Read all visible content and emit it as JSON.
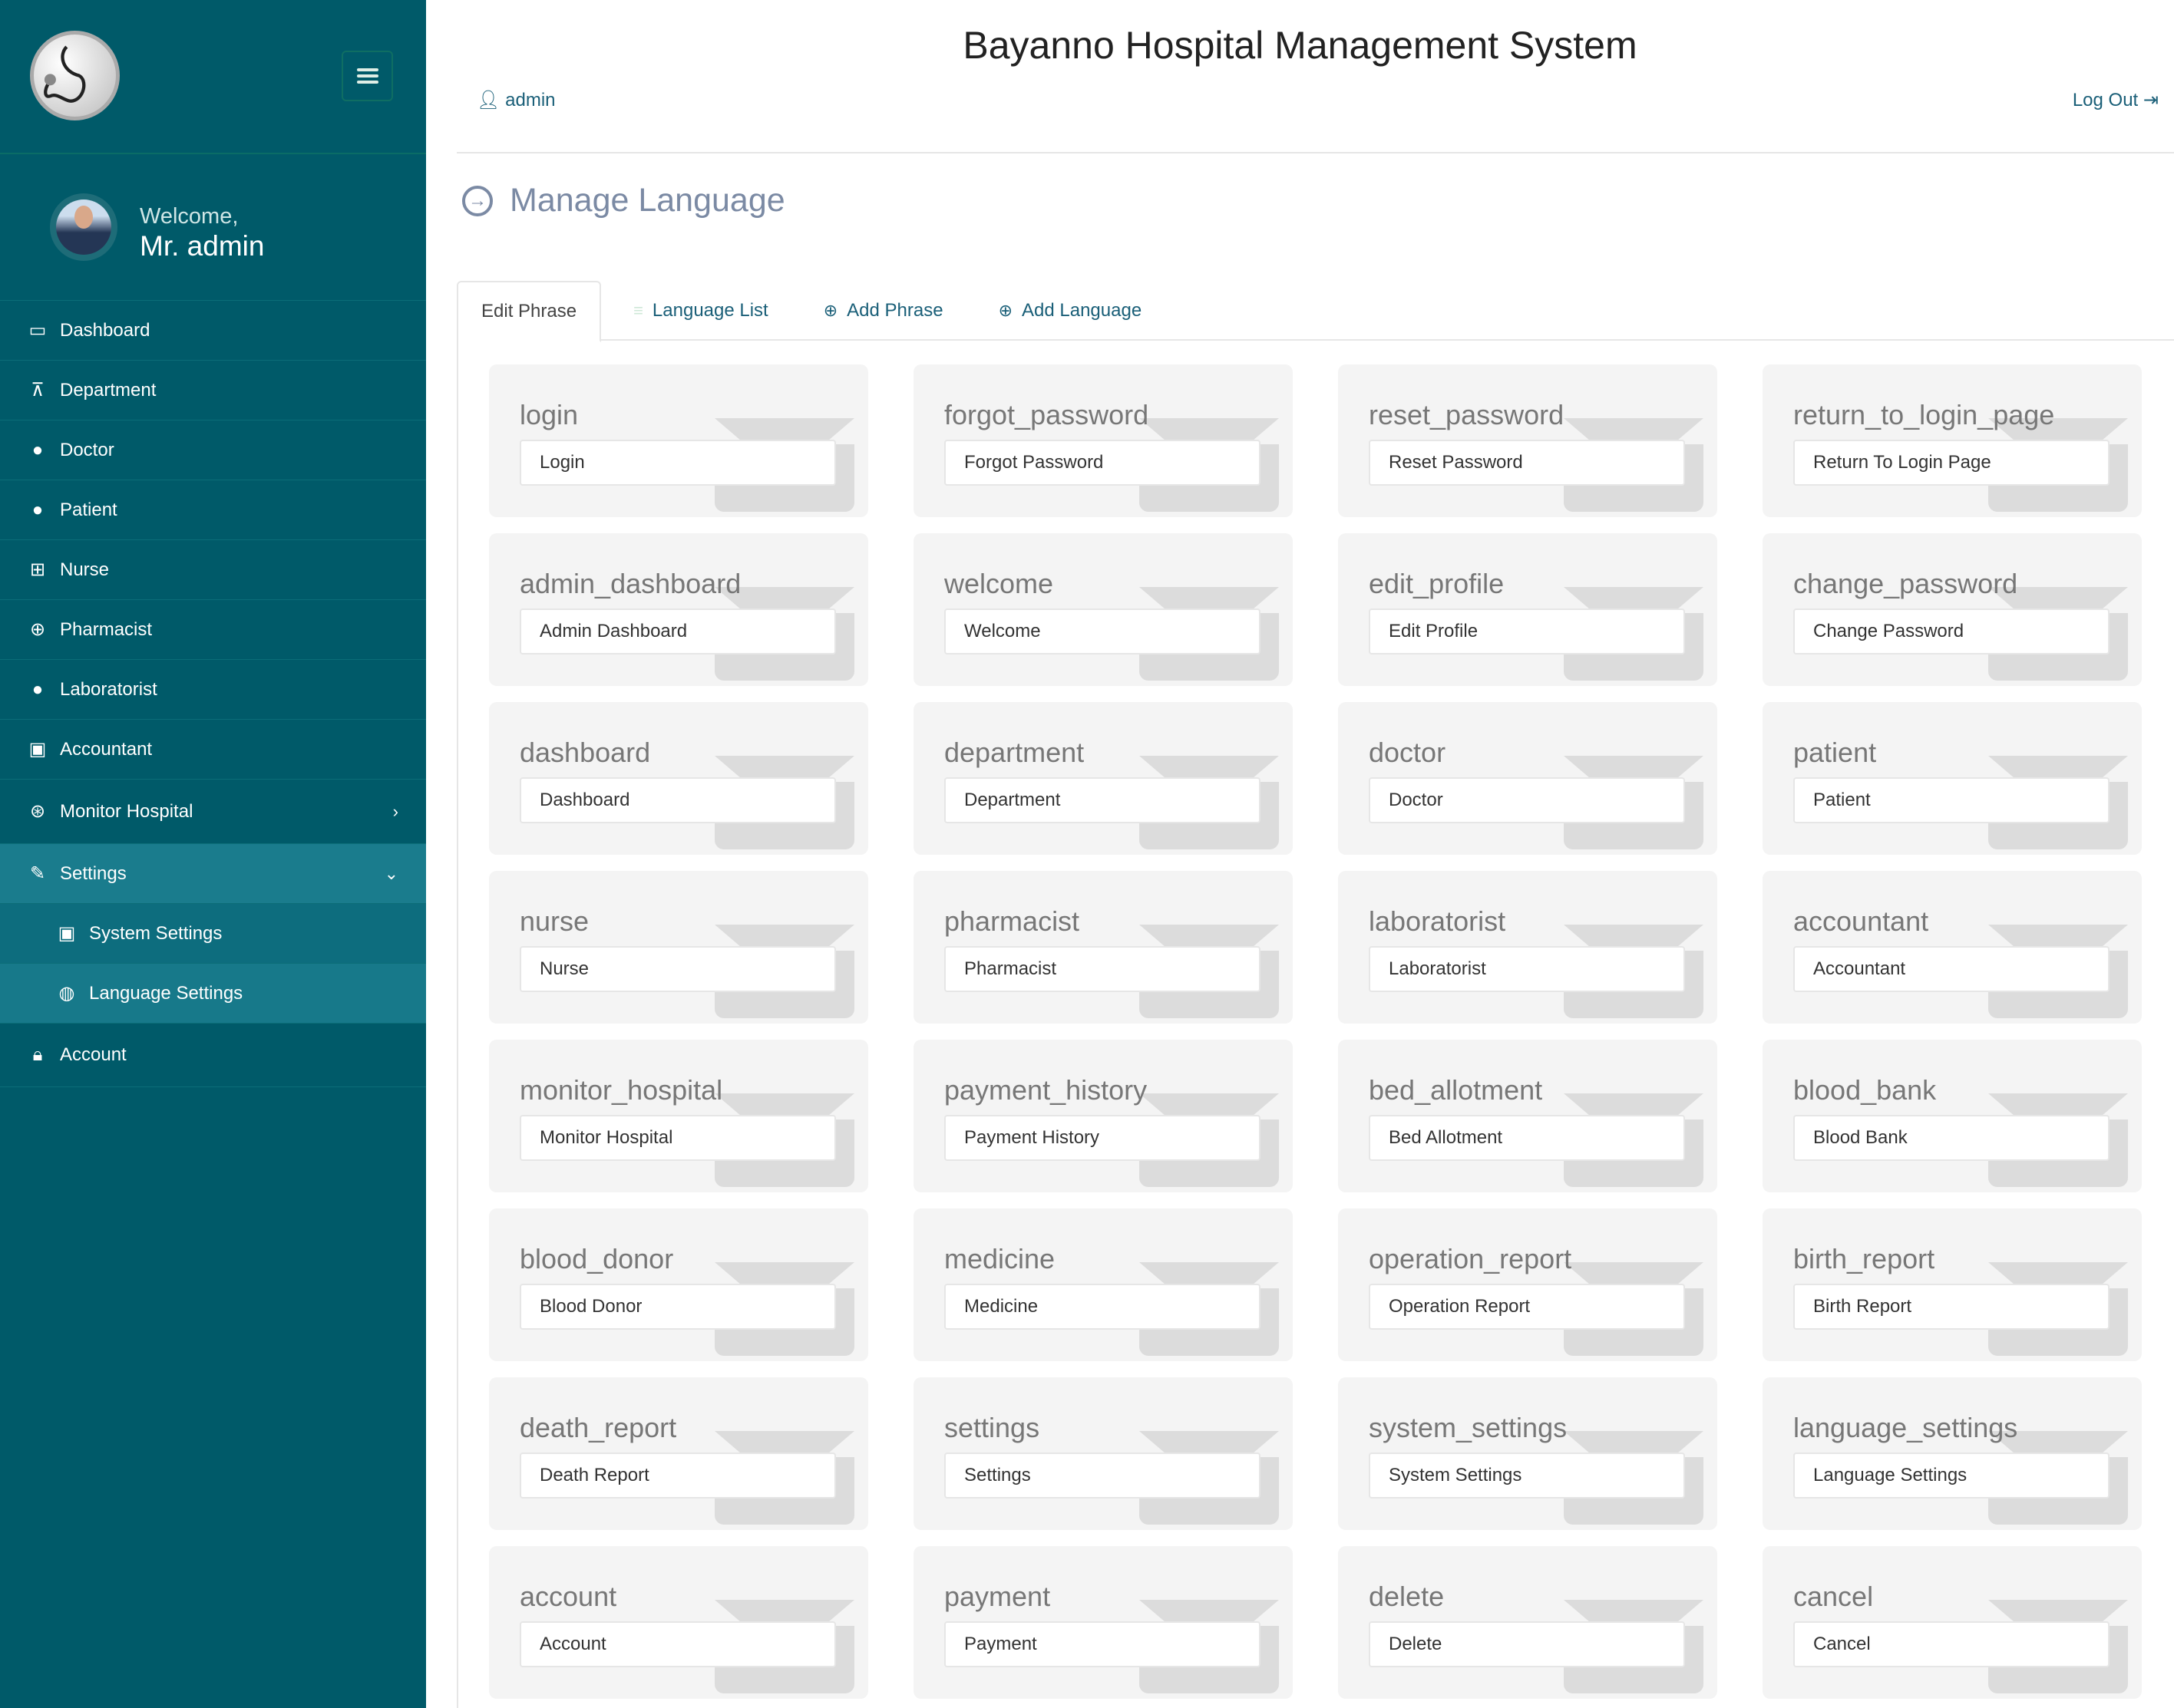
{
  "header": {
    "title": "Bayanno Hospital Management System",
    "user": "admin",
    "logout": "Log Out"
  },
  "profile": {
    "welcome": "Welcome,",
    "name": "Mr. admin"
  },
  "sidebar": {
    "items": [
      {
        "label": "Dashboard",
        "icon": "monitor-icon"
      },
      {
        "label": "Department",
        "icon": "sitemap-icon"
      },
      {
        "label": "Doctor",
        "icon": "user-md-icon"
      },
      {
        "label": "Patient",
        "icon": "user-icon"
      },
      {
        "label": "Nurse",
        "icon": "plus-square-icon"
      },
      {
        "label": "Pharmacist",
        "icon": "medkit-icon"
      },
      {
        "label": "Laboratorist",
        "icon": "user-icon"
      },
      {
        "label": "Accountant",
        "icon": "money-icon"
      },
      {
        "label": "Monitor Hospital",
        "icon": "globe-icon"
      },
      {
        "label": "Settings",
        "icon": "wrench-icon"
      },
      {
        "label": "System Settings",
        "icon": "save-icon"
      },
      {
        "label": "Language Settings",
        "icon": "globe-icon"
      },
      {
        "label": "Account",
        "icon": "lock-icon"
      }
    ]
  },
  "page": {
    "heading": "Manage Language"
  },
  "tabs": [
    {
      "label": "Edit Phrase"
    },
    {
      "label": "Language List"
    },
    {
      "label": "Add Phrase"
    },
    {
      "label": "Add Language"
    }
  ],
  "phrases": [
    [
      "login",
      "Login"
    ],
    [
      "forgot_password",
      "Forgot Password"
    ],
    [
      "reset_password",
      "Reset Password"
    ],
    [
      "return_to_login_page",
      "Return To Login Page"
    ],
    [
      "admin_dashboard",
      "Admin Dashboard"
    ],
    [
      "welcome",
      "Welcome"
    ],
    [
      "edit_profile",
      "Edit Profile"
    ],
    [
      "change_password",
      "Change Password"
    ],
    [
      "dashboard",
      "Dashboard"
    ],
    [
      "department",
      "Department"
    ],
    [
      "doctor",
      "Doctor"
    ],
    [
      "patient",
      "Patient"
    ],
    [
      "nurse",
      "Nurse"
    ],
    [
      "pharmacist",
      "Pharmacist"
    ],
    [
      "laboratorist",
      "Laboratorist"
    ],
    [
      "accountant",
      "Accountant"
    ],
    [
      "monitor_hospital",
      "Monitor Hospital"
    ],
    [
      "payment_history",
      "Payment History"
    ],
    [
      "bed_allotment",
      "Bed Allotment"
    ],
    [
      "blood_bank",
      "Blood Bank"
    ],
    [
      "blood_donor",
      "Blood Donor"
    ],
    [
      "medicine",
      "Medicine"
    ],
    [
      "operation_report",
      "Operation Report"
    ],
    [
      "birth_report",
      "Birth Report"
    ],
    [
      "death_report",
      "Death Report"
    ],
    [
      "settings",
      "Settings"
    ],
    [
      "system_settings",
      "System Settings"
    ],
    [
      "language_settings",
      "Language Settings"
    ],
    [
      "account",
      "Account"
    ],
    [
      "payment",
      "Payment"
    ],
    [
      "delete",
      "Delete"
    ],
    [
      "cancel",
      "Cancel"
    ]
  ]
}
